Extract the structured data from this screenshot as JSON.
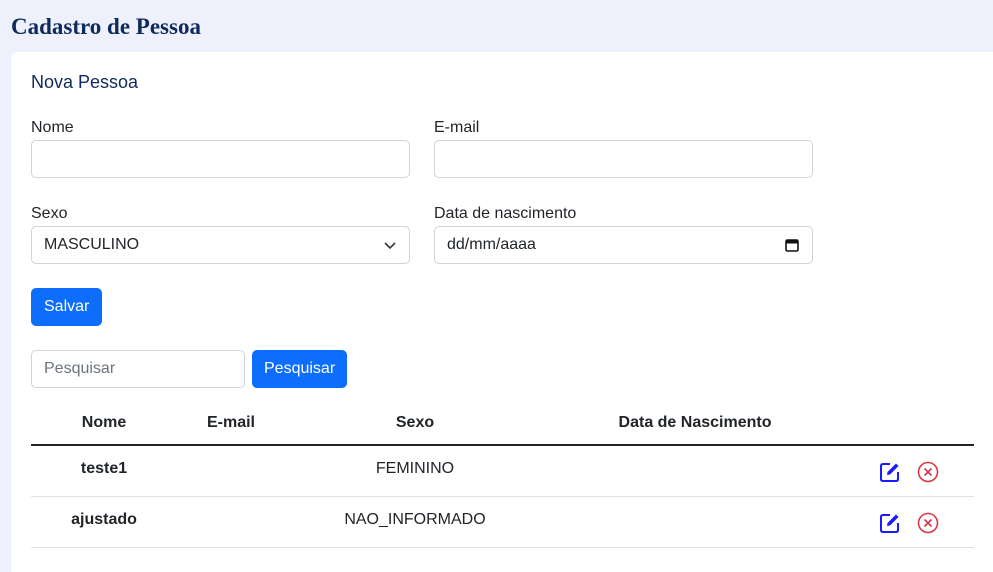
{
  "page": {
    "title": "Cadastro de Pessoa"
  },
  "form": {
    "title": "Nova Pessoa",
    "fields": {
      "nome": {
        "label": "Nome",
        "value": ""
      },
      "email": {
        "label": "E-mail",
        "value": ""
      },
      "sexo": {
        "label": "Sexo",
        "value": "MASCULINO"
      },
      "nascimento": {
        "label": "Data de nascimento",
        "placeholder": "dd/mm/aaaa"
      }
    },
    "save_label": "Salvar"
  },
  "search": {
    "placeholder": "Pesquisar",
    "button_label": "Pesquisar"
  },
  "table": {
    "headers": [
      "Nome",
      "E-mail",
      "Sexo",
      "Data de Nascimento"
    ],
    "rows": [
      {
        "nome": "teste1",
        "email": "",
        "sexo": "FEMININO",
        "nascimento": ""
      },
      {
        "nome": "ajustado",
        "email": "",
        "sexo": "NAO_INFORMADO",
        "nascimento": ""
      }
    ]
  },
  "colors": {
    "primary": "#0d6efd",
    "title": "#0f2a5c",
    "danger": "#dc3545",
    "edit": "#1a1aff"
  },
  "icons": {
    "edit": "edit-icon",
    "delete": "delete-circle-x-icon",
    "select": "chevron-down-icon",
    "calendar": "calendar-icon"
  }
}
